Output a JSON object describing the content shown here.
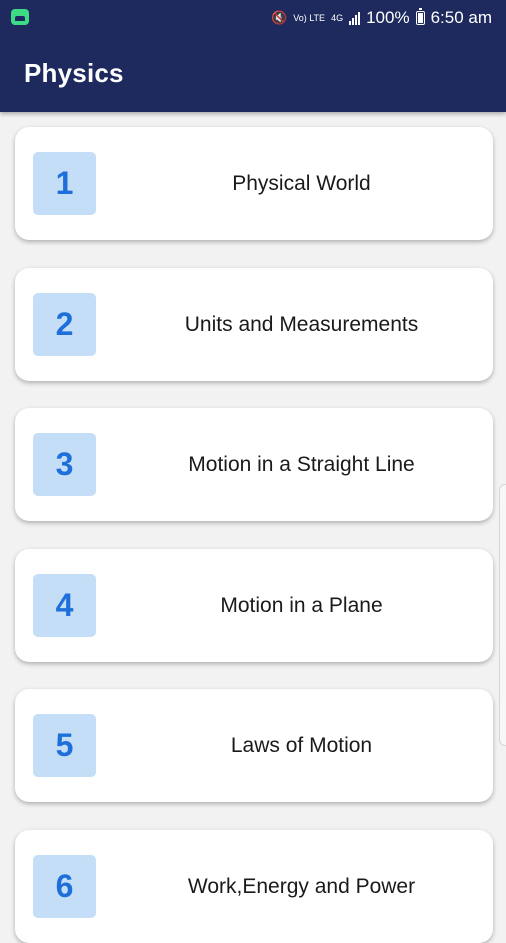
{
  "status_bar": {
    "battery": "100%",
    "time": "6:50 am",
    "volte_label": "Vo) LTE",
    "network_label": "4G"
  },
  "app_bar": {
    "title": "Physics"
  },
  "chapters": [
    {
      "number": "1",
      "title": "Physical World"
    },
    {
      "number": "2",
      "title": "Units and Measurements"
    },
    {
      "number": "3",
      "title": "Motion in a Straight Line"
    },
    {
      "number": "4",
      "title": "Motion in a Plane"
    },
    {
      "number": "5",
      "title": "Laws of Motion"
    },
    {
      "number": "6",
      "title": "Work,Energy and Power"
    }
  ],
  "colors": {
    "app_bar": "#1e2a5e",
    "number_box": "#c3def6",
    "number_text": "#1e6fd9"
  }
}
